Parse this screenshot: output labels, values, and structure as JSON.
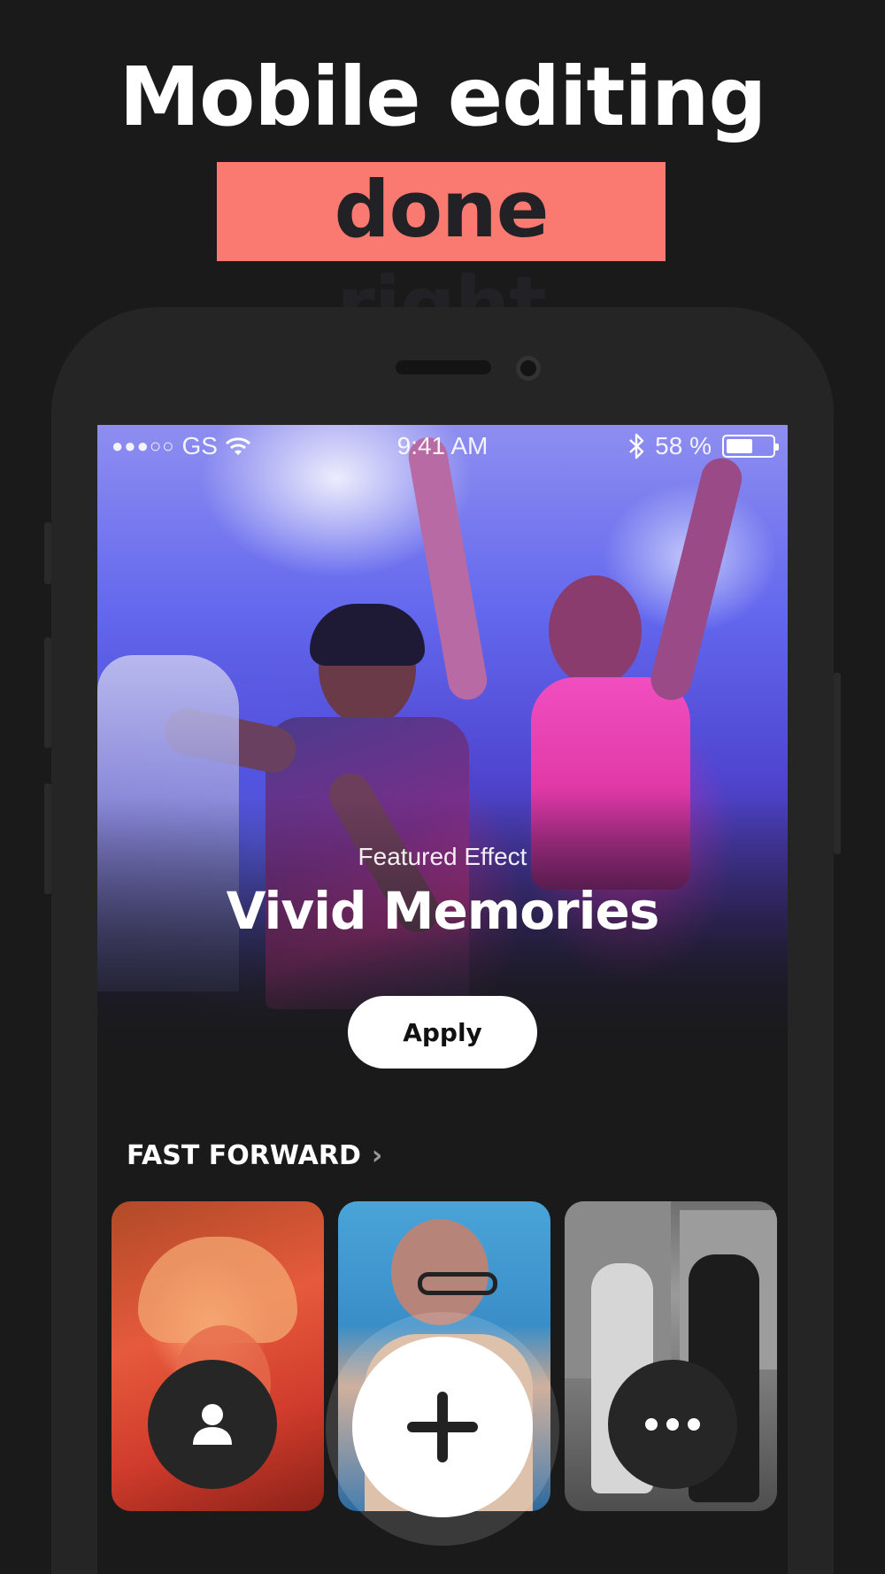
{
  "promo": {
    "headline_line1": "Mobile editing",
    "headline_line2": "done right",
    "highlight_color": "#fa7a72"
  },
  "status_bar": {
    "carrier": "GS",
    "signal_dots": "●●●○○",
    "time": "9:41 AM",
    "battery": "58 %",
    "battery_level": 0.58
  },
  "hero": {
    "label": "Featured Effect",
    "title": "Vivid Memories",
    "apply_label": "Apply"
  },
  "section": {
    "title": "FAST FORWARD",
    "chevron": "›"
  },
  "tab_bar": {
    "profile_icon": "person-icon",
    "add_icon": "plus-icon",
    "more_icon": "ellipsis-icon"
  }
}
